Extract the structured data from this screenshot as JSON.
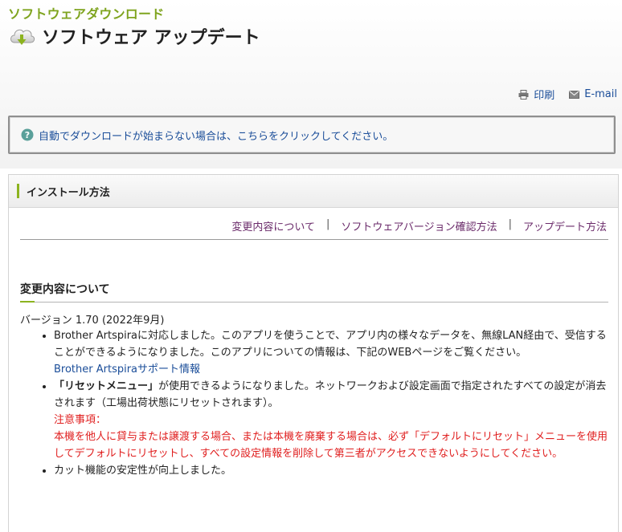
{
  "header": {
    "section_label": "ソフトウェアダウンロード",
    "page_title": "ソフトウェア アップデート"
  },
  "utility": {
    "print_label": "印刷",
    "email_label": "E-mail"
  },
  "notice": {
    "text": "自動でダウンロードが始まらない場合は、こちらをクリックしてください。"
  },
  "panel": {
    "title": "インストール方法",
    "nav": {
      "link1": "変更内容について",
      "link2": "ソフトウェアバージョン確認方法",
      "link3": "アップデート方法",
      "separator": "|"
    }
  },
  "changes": {
    "heading": "変更内容について",
    "version": "バージョン 1.70 (2022年9月)",
    "item1_text": "Brother Artspiraに対応しました。このアプリを使うことで、アプリ内の様々なデータを、無線LAN経由で、受信することができるようになりました。このアプリについての情報は、下記のWEBページをご覧ください。",
    "item1_link": "Brother Artspiraサポート情報",
    "item2_bold": "「リセットメニュー」",
    "item2_text": "が使用できるようになりました。ネットワークおよび設定画面で指定されたすべての設定が消去されます（工場出荷状態にリセットされます）。",
    "item2_caution_label": "注意事項：",
    "item2_caution_text": "本機を他人に貸与または譲渡する場合、または本機を廃棄する場合は、必ず「デフォルトにリセット」メニューを使用してデフォルトにリセットし、すべての設定情報を削除して第三者がアクセスできないようにしてください。",
    "item3_text": "カット機能の安定性が向上しました。"
  },
  "colors": {
    "accent_green": "#8cb31f",
    "section_label_green": "#7fa41f",
    "link_blue": "#1a4d99",
    "nav_link_purple": "#6a2a6a",
    "caution_red": "#e02020"
  }
}
